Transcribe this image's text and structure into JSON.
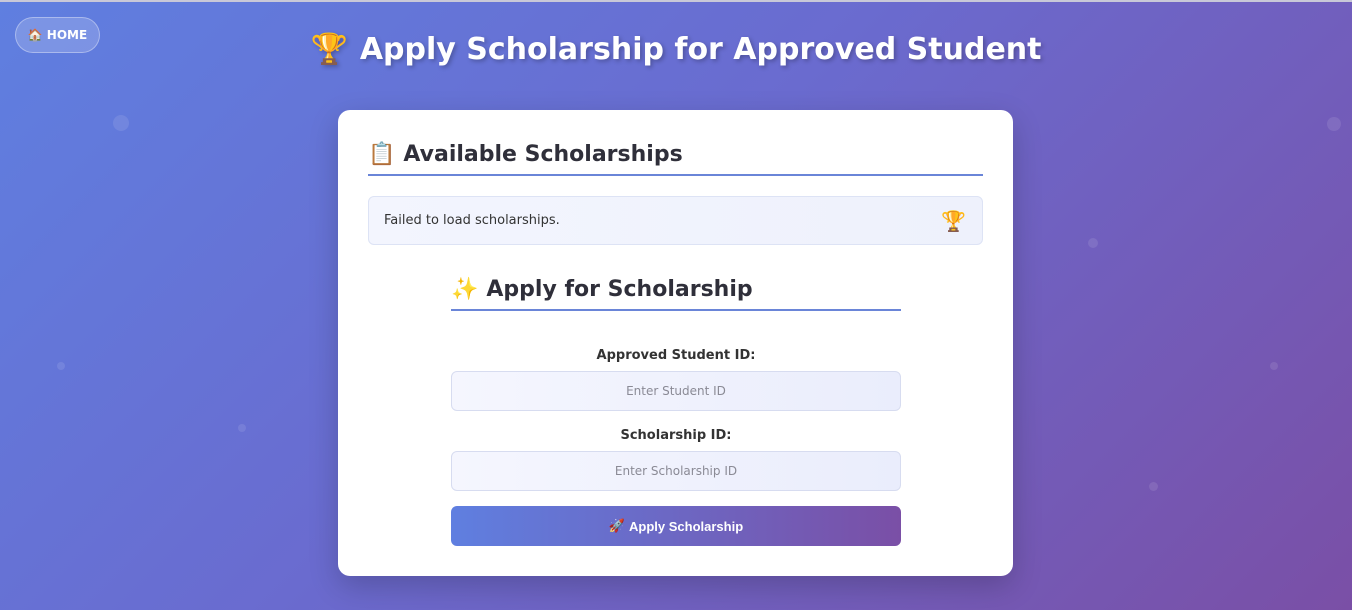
{
  "nav": {
    "home_icon": "🏠",
    "home_label": "HOME"
  },
  "header": {
    "icon": "🏆",
    "title": "Apply Scholarship for Approved Student"
  },
  "scholarships": {
    "icon": "📋",
    "title": "Available Scholarships",
    "message": "Failed to load scholarships.",
    "message_icon": "🏆"
  },
  "apply": {
    "icon": "✨",
    "title": "Apply for Scholarship",
    "student_id_label": "Approved Student ID:",
    "student_id_placeholder": "Enter Student ID",
    "scholarship_id_label": "Scholarship ID:",
    "scholarship_id_placeholder": "Enter Scholarship ID",
    "submit_icon": "🚀",
    "submit_label": "Apply Scholarship"
  },
  "colors": {
    "accent_start": "#5f7fe0",
    "accent_end": "#7a4fa6",
    "divider": "#6a85d8"
  }
}
